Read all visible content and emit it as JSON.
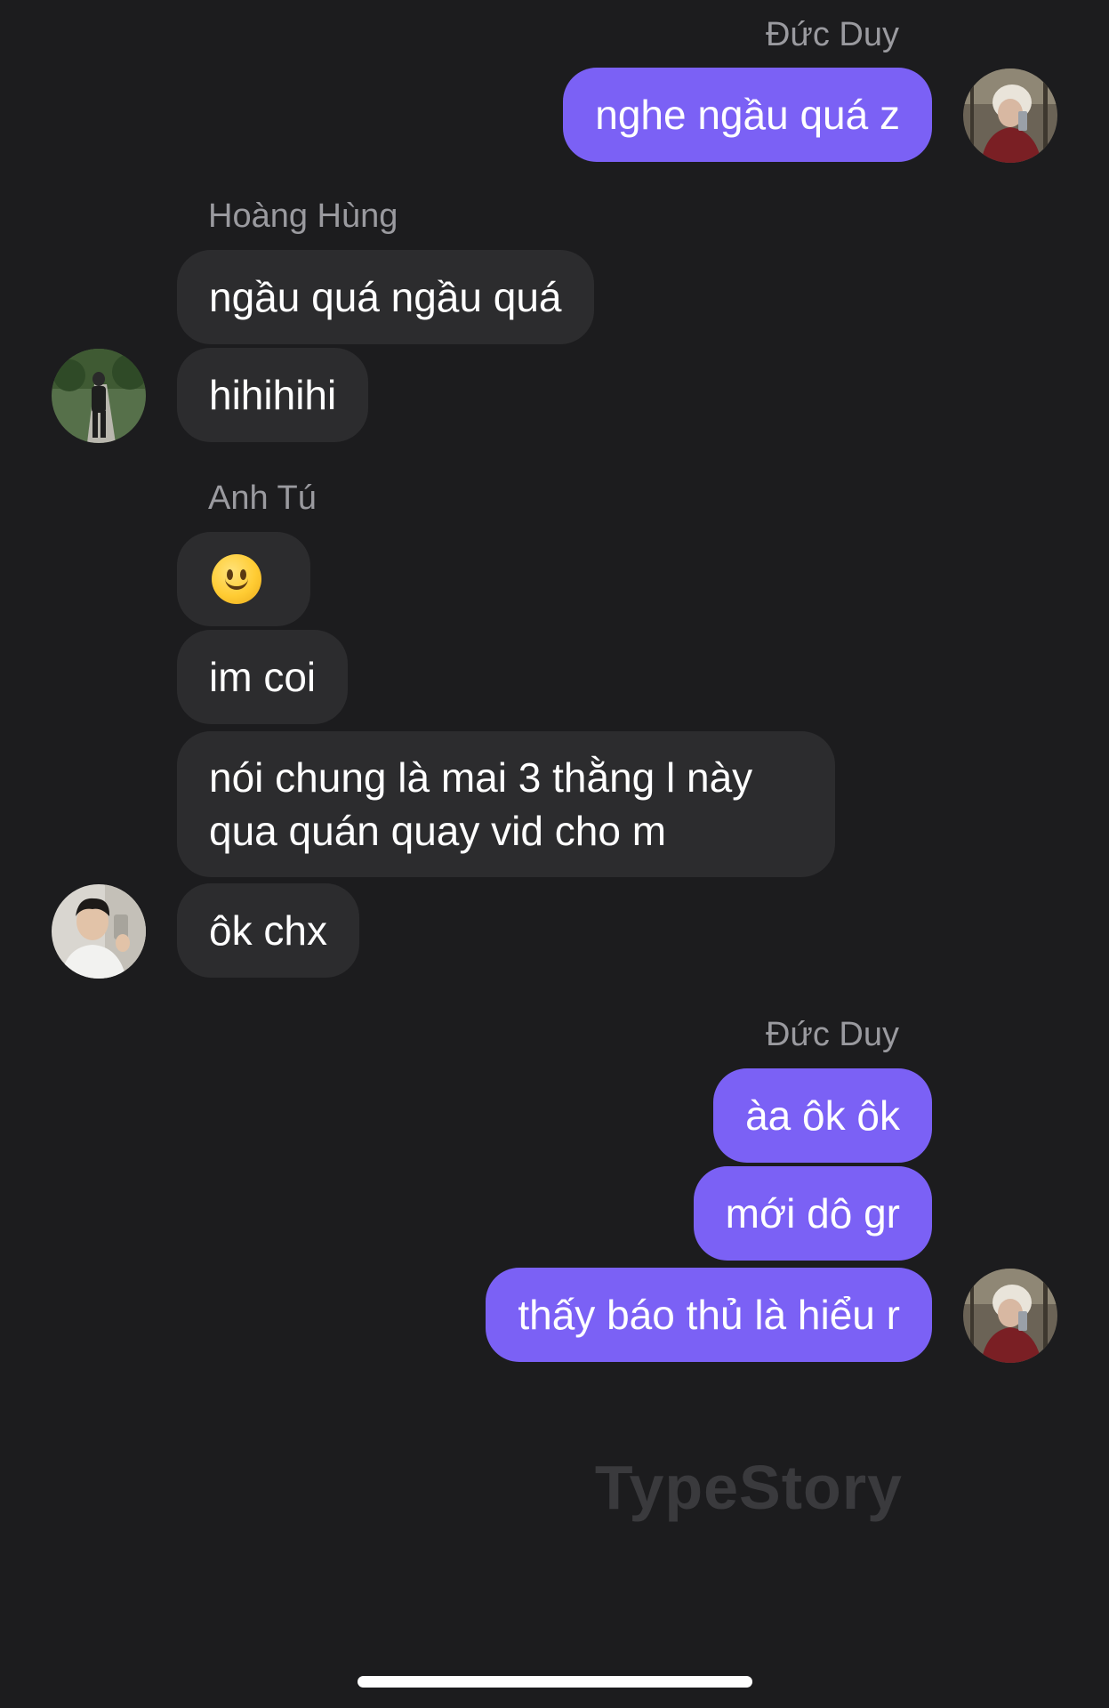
{
  "watermark": "TypeStory",
  "groups": [
    {
      "sender": "Đức Duy",
      "messages": [
        "nghe ngầu quá z"
      ]
    },
    {
      "sender": "Hoàng Hùng",
      "messages": [
        "ngầu quá ngầu quá",
        "hihihihi"
      ]
    },
    {
      "sender": "Anh Tú",
      "messages": [
        "🙂",
        "im coi",
        "nói chung là mai 3 thằng l này qua quán quay vid cho m",
        "ôk chx"
      ]
    },
    {
      "sender": "Đức Duy",
      "messages": [
        "àa ôk ôk",
        "mới dô gr",
        "thấy báo thủ là hiểu r"
      ]
    }
  ],
  "icons": {
    "smile_emoji": "slightly-smiling-face-icon"
  },
  "colors": {
    "background": "#1c1c1e",
    "outgoing_bubble": "#7b61f5",
    "incoming_bubble": "#2c2c2e",
    "sender_name": "#9a9a9f",
    "watermark": "#3a3a3d"
  }
}
